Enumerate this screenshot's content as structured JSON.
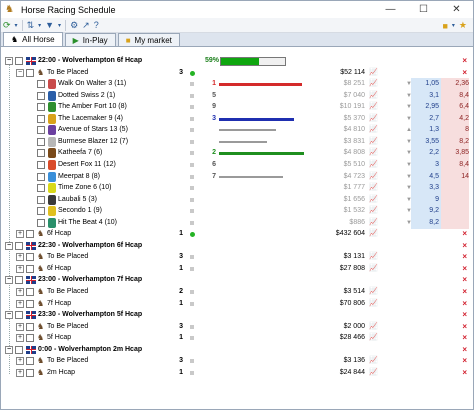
{
  "window": {
    "title": "Horse Racing Schedule"
  },
  "toolbar": {
    "left_icons": [
      "refresh-icon",
      "dropdown-icon",
      "sort-icon",
      "dropdown-icon",
      "filter-icon",
      "dropdown-icon",
      "settings-icon",
      "export-icon",
      "help-icon"
    ],
    "right_icons": [
      "palette-icon",
      "dropdown-icon",
      "star-icon"
    ]
  },
  "tabs": [
    {
      "label": "All Horse",
      "active": true
    },
    {
      "label": "In-Play",
      "active": false
    },
    {
      "label": "My market",
      "active": false
    }
  ],
  "progress": {
    "percent_label": "59%",
    "fraction": 0.59
  },
  "events": [
    {
      "time_title": "22:00 - Wolverhampton 6f Hcap",
      "markets": [
        {
          "name": "To Be Placed",
          "places": "3",
          "matched": "$52 114",
          "expanded": true,
          "status": "green",
          "runners": [
            {
              "name": "Walk On Walter 3 (11)",
              "matched": "$8 251",
              "rank": "1",
              "bar_fraction": 0.9,
              "bar_color": "#d42a2a",
              "arrow": "▼",
              "back": "1,05",
              "lay": "2,36",
              "silk": "#c94b4b"
            },
            {
              "name": "Dotted Swiss 2 (1)",
              "matched": "$7 040",
              "rank": "5",
              "bar_fraction": 0.0,
              "bar_color": "#9a9a9a",
              "arrow": "▼",
              "back": "3,1",
              "lay": "8,4",
              "silk": "#2a5ea8"
            },
            {
              "name": "The Amber Fort 10 (8)",
              "matched": "$10 191",
              "rank": "9",
              "bar_fraction": 0.0,
              "bar_color": "#9a9a9a",
              "arrow": "▼",
              "back": "2,95",
              "lay": "6,4",
              "silk": "#2f8f2f"
            },
            {
              "name": "The Lacemaker 9 (4)",
              "matched": "$5 370",
              "rank": "3",
              "bar_fraction": 0.82,
              "bar_color": "#1f2fb0",
              "arrow": "▼",
              "back": "2,7",
              "lay": "4,2",
              "silk": "#d9a21b"
            },
            {
              "name": "Avenue of Stars 13 (5)",
              "matched": "$4 810",
              "rank": "",
              "bar_fraction": 0.62,
              "bar_color": "#9a9a9a",
              "arrow": "▲",
              "back": "1,3",
              "lay": "8",
              "silk": "#6b3fa0"
            },
            {
              "name": "Burmese Blazer 12 (7)",
              "matched": "$3 831",
              "rank": "",
              "bar_fraction": 0.52,
              "bar_color": "#9a9a9a",
              "arrow": "▼",
              "back": "3,55",
              "lay": "8,2",
              "silk": "#b7b7b7"
            },
            {
              "name": "Katheefa 7 (6)",
              "matched": "$4 808",
              "rank": "2",
              "bar_fraction": 0.92,
              "bar_color": "#1f8f1f",
              "arrow": "▼",
              "back": "2,2",
              "lay": "3,85",
              "silk": "#7a4a1a"
            },
            {
              "name": "Desert Fox 11 (12)",
              "matched": "$5 510",
              "rank": "6",
              "bar_fraction": 0.0,
              "bar_color": "#9a9a9a",
              "arrow": "▼",
              "back": "3",
              "lay": "8,4",
              "silk": "#d94b2a"
            },
            {
              "name": "Meerpat 8 (8)",
              "matched": "$4 723",
              "rank": "7",
              "bar_fraction": 0.7,
              "bar_color": "#9a9a9a",
              "arrow": "▼",
              "back": "4,5",
              "lay": "14",
              "silk": "#3a8fd9"
            },
            {
              "name": "Time Zone 6 (10)",
              "matched": "$1 777",
              "rank": "",
              "bar_fraction": 0.0,
              "bar_color": "#9a9a9a",
              "arrow": "▼",
              "back": "3,3",
              "lay": "",
              "silk": "#d9d91b"
            },
            {
              "name": "Laubali 5 (3)",
              "matched": "$1 656",
              "rank": "",
              "bar_fraction": 0.0,
              "bar_color": "#9a9a9a",
              "arrow": "▼",
              "back": "9",
              "lay": "",
              "silk": "#3a3a3a"
            },
            {
              "name": "Secondo 1 (9)",
              "matched": "$1 532",
              "rank": "",
              "bar_fraction": 0.0,
              "bar_color": "#9a9a9a",
              "arrow": "▼",
              "back": "9,2",
              "lay": "",
              "silk": "#e0c020"
            },
            {
              "name": "Hit The Beat 4 (10)",
              "matched": "$886",
              "rank": "",
              "bar_fraction": 0.0,
              "bar_color": "#9a9a9a",
              "arrow": "▼",
              "back": "8,2",
              "lay": "",
              "silk": "#2a8f6a"
            }
          ]
        },
        {
          "name": "6f Hcap",
          "places": "1",
          "matched": "$432 604",
          "expanded": false,
          "status": "green",
          "runners": []
        }
      ]
    },
    {
      "time_title": "22:30 - Wolverhampton 6f Hcap",
      "markets": [
        {
          "name": "To Be Placed",
          "places": "3",
          "matched": "$3 131",
          "expanded": false,
          "status": "",
          "runners": []
        },
        {
          "name": "6f Hcap",
          "places": "1",
          "matched": "$27 808",
          "expanded": false,
          "status": "",
          "runners": []
        }
      ]
    },
    {
      "time_title": "23:00 - Wolverhampton 7f Hcap",
      "markets": [
        {
          "name": "To Be Placed",
          "places": "2",
          "matched": "$3 514",
          "expanded": false,
          "status": "",
          "runners": []
        },
        {
          "name": "7f Hcap",
          "places": "1",
          "matched": "$70 806",
          "expanded": false,
          "status": "",
          "runners": []
        }
      ]
    },
    {
      "time_title": "23:30 - Wolverhampton 5f Hcap",
      "markets": [
        {
          "name": "To Be Placed",
          "places": "3",
          "matched": "$2 000",
          "expanded": false,
          "status": "",
          "runners": []
        },
        {
          "name": "5f Hcap",
          "places": "1",
          "matched": "$28 466",
          "expanded": false,
          "status": "",
          "runners": []
        }
      ]
    },
    {
      "time_title": "0:00 - Wolverhampton 2m Hcap",
      "markets": [
        {
          "name": "To Be Placed",
          "places": "3",
          "matched": "$3 136",
          "expanded": false,
          "status": "",
          "runners": []
        },
        {
          "name": "2m Hcap",
          "places": "1",
          "matched": "$24 844",
          "expanded": false,
          "status": "",
          "runners": []
        }
      ]
    }
  ]
}
